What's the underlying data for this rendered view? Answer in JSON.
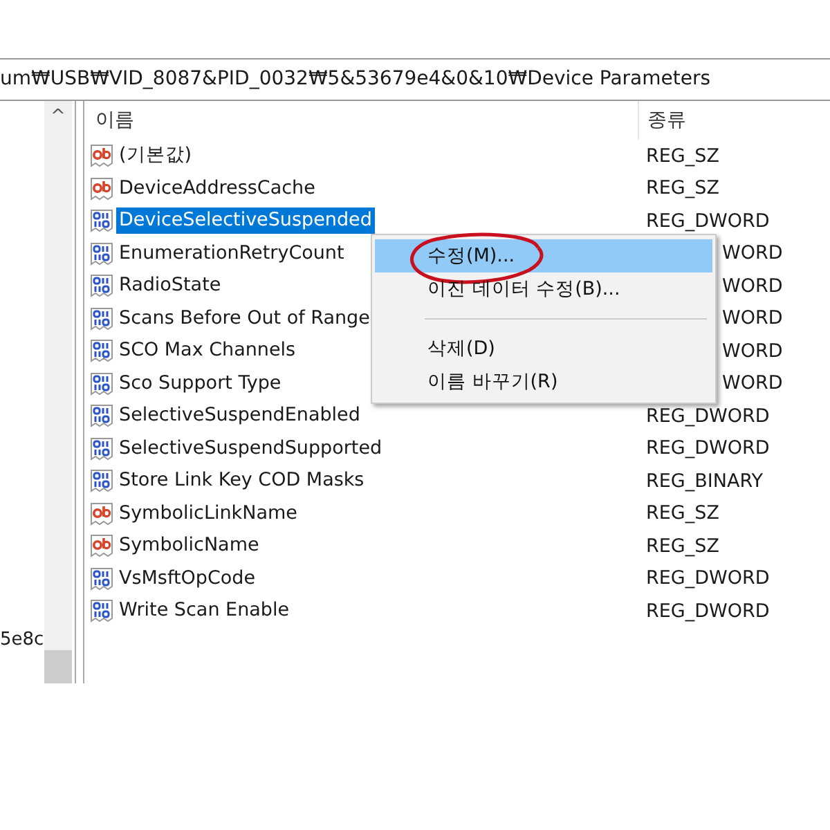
{
  "address_bar": {
    "path": "um₩USB₩VID_8087&PID_0032₩5&53679e4&0&10₩Device Parameters"
  },
  "tree": {
    "scroll_up": "^",
    "visible_text": "5e8c"
  },
  "values": {
    "columns": [
      "이름",
      "종류"
    ],
    "rows": [
      {
        "name": "(기본값)",
        "kind": "string",
        "type": "REG_SZ",
        "selected": false,
        "type_partial": false
      },
      {
        "name": "DeviceAddressCache",
        "kind": "string",
        "type": "REG_SZ",
        "selected": false,
        "type_partial": false
      },
      {
        "name": "DeviceSelectiveSuspended",
        "kind": "binary",
        "type": "REG_DWORD",
        "selected": true,
        "type_partial": false
      },
      {
        "name": "EnumerationRetryCount",
        "kind": "binary",
        "type": "WORD",
        "selected": false,
        "type_partial": true
      },
      {
        "name": "RadioState",
        "kind": "binary",
        "type": "WORD",
        "selected": false,
        "type_partial": true
      },
      {
        "name": "Scans Before Out of Range",
        "kind": "binary",
        "type": "WORD",
        "selected": false,
        "type_partial": true
      },
      {
        "name": "SCO Max Channels",
        "kind": "binary",
        "type": "WORD",
        "selected": false,
        "type_partial": true
      },
      {
        "name": "Sco Support Type",
        "kind": "binary",
        "type": "WORD",
        "selected": false,
        "type_partial": true
      },
      {
        "name": "SelectiveSuspendEnabled",
        "kind": "binary",
        "type": "REG_DWORD",
        "selected": false,
        "type_partial": false
      },
      {
        "name": "SelectiveSuspendSupported",
        "kind": "binary",
        "type": "REG_DWORD",
        "selected": false,
        "type_partial": false
      },
      {
        "name": "Store Link Key COD Masks",
        "kind": "binary",
        "type": "REG_BINARY",
        "selected": false,
        "type_partial": false
      },
      {
        "name": "SymbolicLinkName",
        "kind": "string",
        "type": "REG_SZ",
        "selected": false,
        "type_partial": false
      },
      {
        "name": "SymbolicName",
        "kind": "string",
        "type": "REG_SZ",
        "selected": false,
        "type_partial": false
      },
      {
        "name": "VsMsftOpCode",
        "kind": "binary",
        "type": "REG_DWORD",
        "selected": false,
        "type_partial": false
      },
      {
        "name": "Write Scan Enable",
        "kind": "binary",
        "type": "REG_DWORD",
        "selected": false,
        "type_partial": false
      }
    ]
  },
  "context_menu": {
    "items": [
      {
        "kind": "item",
        "label": "수정(M)...",
        "selected": true,
        "circled": true
      },
      {
        "kind": "item",
        "label": "이진 데이터 수정(B)...",
        "selected": false,
        "circled": false
      },
      {
        "kind": "separator"
      },
      {
        "kind": "item",
        "label": "삭제(D)",
        "selected": false,
        "circled": false
      },
      {
        "kind": "item",
        "label": "이름 바꾸기(R)",
        "selected": false,
        "circled": false
      }
    ]
  }
}
